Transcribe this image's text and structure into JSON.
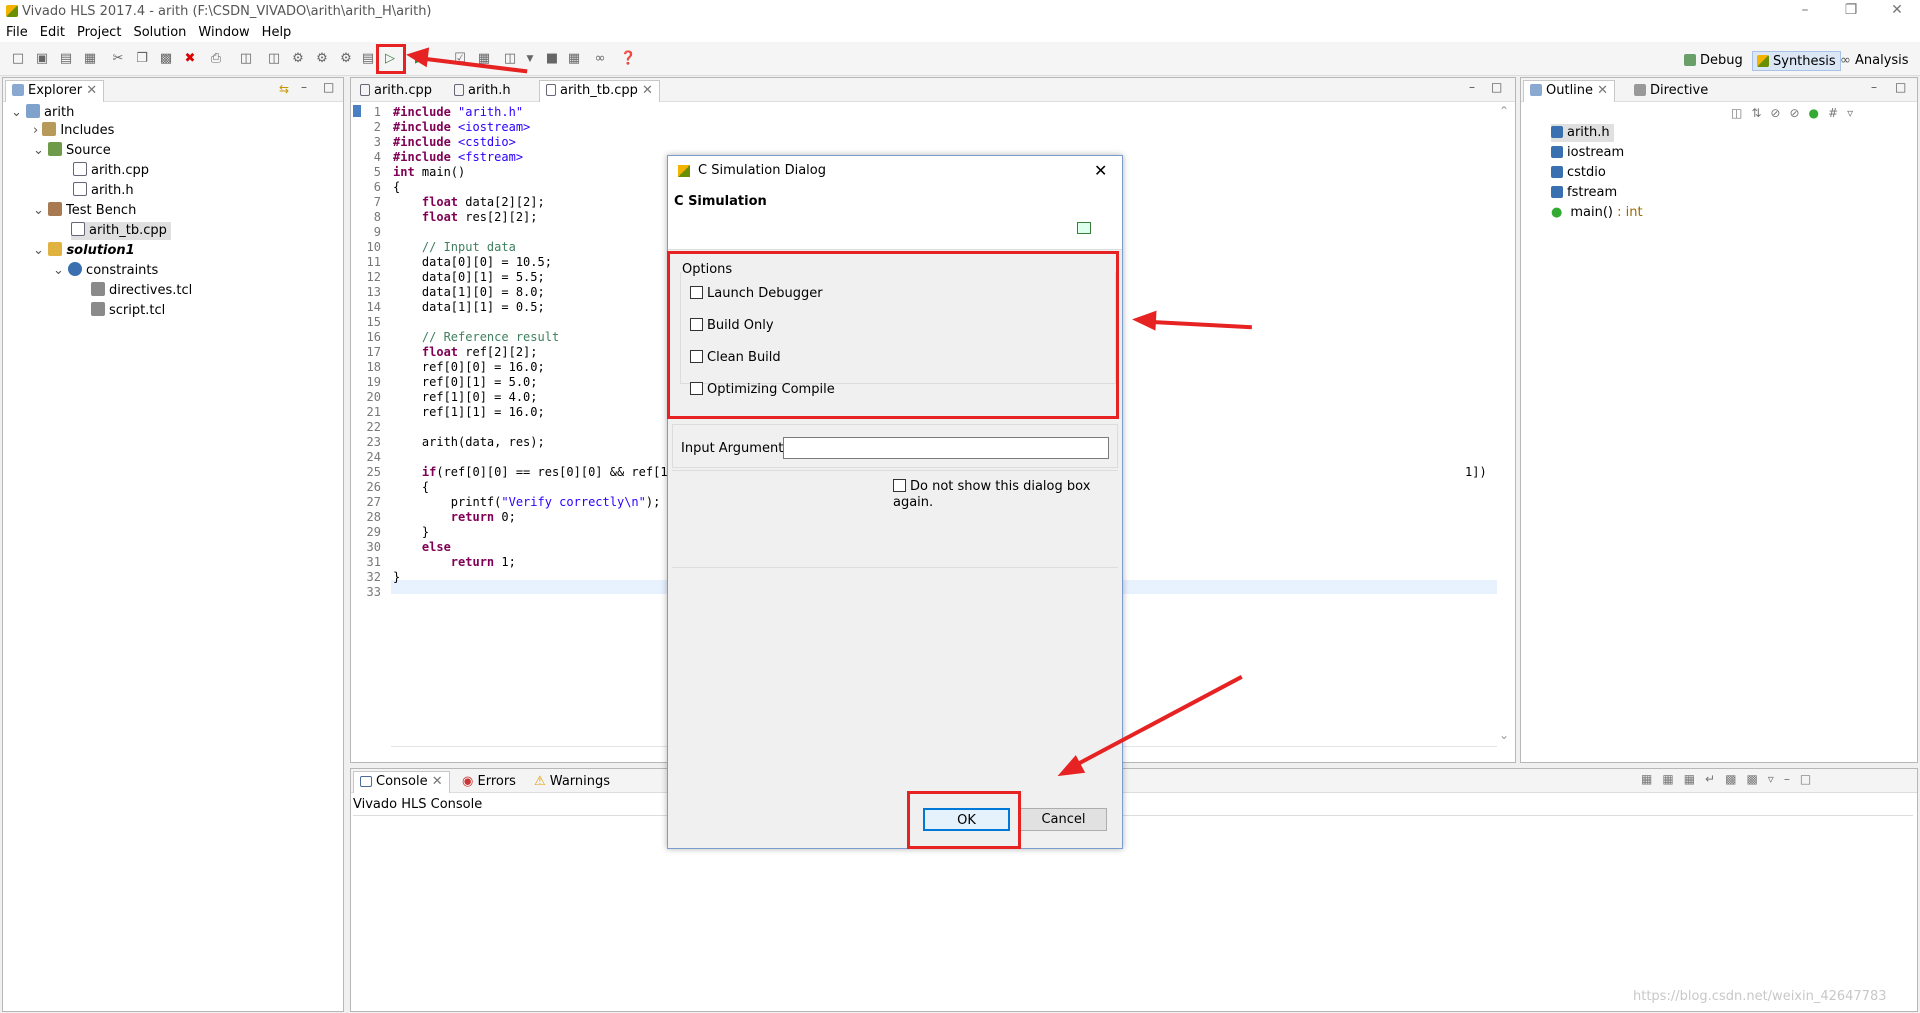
{
  "window": {
    "title": "Vivado HLS 2017.4 - arith (F:\\CSDN_VIVADO\\arith\\arith_H\\arith)"
  },
  "menu": [
    "File",
    "Edit",
    "Project",
    "Solution",
    "Window",
    "Help"
  ],
  "perspectives": {
    "debug": "Debug",
    "synthesis": "Synthesis",
    "analysis": "Analysis"
  },
  "explorer": {
    "tab": "Explorer",
    "items": [
      {
        "label": "arith"
      },
      {
        "label": "Includes"
      },
      {
        "label": "Source"
      },
      {
        "label": "arith.cpp"
      },
      {
        "label": "arith.h"
      },
      {
        "label": "Test Bench"
      },
      {
        "label": "arith_tb.cpp"
      },
      {
        "label": "solution1"
      },
      {
        "label": "constraints"
      },
      {
        "label": "directives.tcl"
      },
      {
        "label": "script.tcl"
      }
    ]
  },
  "editor": {
    "tabs": [
      "arith.cpp",
      "arith.h",
      "arith_tb.cpp"
    ],
    "line_numbers": [
      "1",
      "2",
      "3",
      "4",
      "5",
      "6",
      "7",
      "8",
      "9",
      "10",
      "11",
      "12",
      "13",
      "14",
      "15",
      "16",
      "17",
      "18",
      "19",
      "20",
      "21",
      "22",
      "23",
      "24",
      "25",
      "26",
      "27",
      "28",
      "29",
      "30",
      "31",
      "32",
      "33"
    ],
    "lines": [
      "#include \"arith.h\"",
      "#include <iostream>",
      "#include <cstdio>",
      "#include <fstream>",
      "int main()",
      "{",
      "    float data[2][2];",
      "    float res[2][2];",
      "",
      "    // Input data",
      "    data[0][0] = 10.5;",
      "    data[0][1] = 5.5;",
      "    data[1][0] = 8.0;",
      "    data[1][1] = 0.5;",
      "",
      "    // Reference result",
      "    float ref[2][2];",
      "    ref[0][0] = 16.0;",
      "    ref[0][1] = 5.0;",
      "    ref[1][0] = 4.0;",
      "    ref[1][1] = 16.0;",
      "",
      "    arith(data, res);",
      "",
      "    if(ref[0][0] == res[0][0] && ref[1][",
      "    {",
      "        printf(\"Verify correctly\\n\");",
      "        return 0;",
      "    }",
      "    else",
      "        return 1;",
      "}",
      ""
    ],
    "line25_tail": "1])"
  },
  "outline": {
    "tabs": [
      "Outline",
      "Directive"
    ],
    "items": [
      {
        "label": "arith.h"
      },
      {
        "label": "iostream"
      },
      {
        "label": "cstdio"
      },
      {
        "label": "fstream"
      },
      {
        "label": "main()",
        "type": " : int"
      }
    ]
  },
  "console": {
    "tabs": [
      "Console",
      "Errors",
      "Warnings"
    ],
    "title": "Vivado HLS Console"
  },
  "dialog": {
    "title": "C Simulation Dialog",
    "heading": "C Simulation",
    "options_label": "Options",
    "options": [
      {
        "label": "Launch Debugger",
        "checked": false
      },
      {
        "label": "Build Only",
        "checked": false
      },
      {
        "label": "Clean Build",
        "checked": false
      },
      {
        "label": "Optimizing Compile",
        "checked": false
      }
    ],
    "input_args_label": "Input Arguments",
    "input_args_value": "",
    "dont_show_label": "Do not show this dialog box again.",
    "ok": "OK",
    "cancel": "Cancel"
  },
  "watermark": "https://blog.csdn.net/weixin_42647783",
  "colors": {
    "annotation": "#e62222",
    "accent": "#7a9cd0"
  }
}
